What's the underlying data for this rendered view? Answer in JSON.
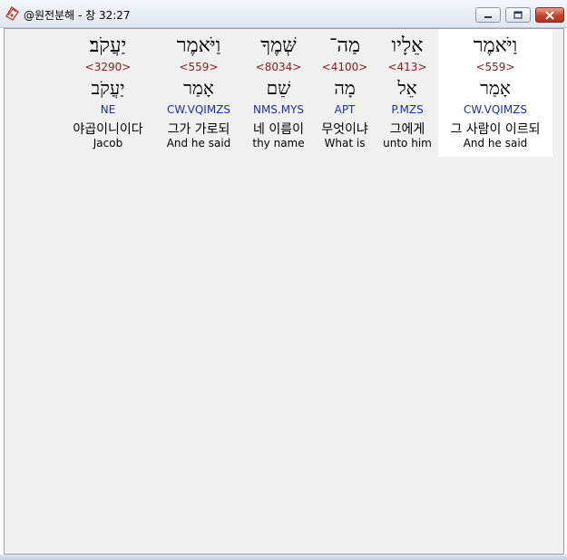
{
  "window": {
    "title": "@원전분해 - 창 32:27"
  },
  "colors": {
    "strong_number": "#8b1a1a",
    "parsing_code": "#1a2fb0",
    "selected_column": "#ffffff",
    "background": "#f0f0f0"
  },
  "words": [
    {
      "hebrew": "וַיֹּאמֶר",
      "strong": "<559>",
      "lemma": "אָמַר",
      "parse": "CW.VQIMZS",
      "korean": "그 사람이 이르되",
      "english": "And he said",
      "selected": true
    },
    {
      "hebrew": "אֵלָיו",
      "strong": "<413>",
      "lemma": "אֵל",
      "parse": "P.MZS",
      "korean": "그에게",
      "english": "unto him",
      "selected": false
    },
    {
      "hebrew": "מַה־",
      "strong": "<4100>",
      "lemma": "מָה",
      "parse": "APT",
      "korean": "무엇이냐",
      "english": "What is",
      "selected": false
    },
    {
      "hebrew": "שְּׁמֶךָ",
      "strong": "<8034>",
      "lemma": "שֵׁם",
      "parse": "NMS.MYS",
      "korean": "네 이름이",
      "english": "thy name",
      "selected": false
    },
    {
      "hebrew": "וַיֹּאמֶר",
      "strong": "<559>",
      "lemma": "אָמַר",
      "parse": "CW.VQIMZS",
      "korean": "그가 가로되",
      "english": "And he said",
      "selected": false
    },
    {
      "hebrew": "יַעֲקֹב׃",
      "strong": "<3290>",
      "lemma": "יַעֲקֹב",
      "parse": "NE",
      "korean": "야곱이니이다",
      "english": "Jacob",
      "selected": false
    }
  ]
}
